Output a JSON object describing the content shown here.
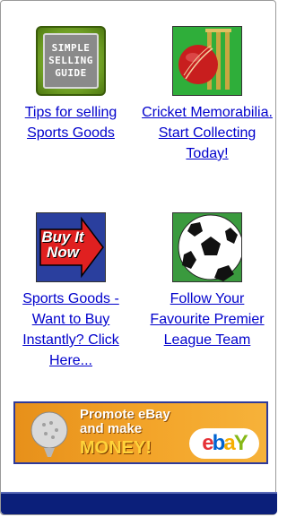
{
  "tiles": [
    {
      "image_lines": [
        "SIMPLE",
        "SELLING",
        "GUIDE"
      ],
      "link": "Tips for selling Sports Goods",
      "icon": "simple-selling-guide-icon"
    },
    {
      "link": "Cricket Memorabilia. Start Collecting Today!",
      "icon": "cricket-ball-stumps-icon"
    },
    {
      "image_lines": [
        "Buy It",
        "Now"
      ],
      "link": "Sports Goods - Want to Buy Instantly? Click Here...",
      "icon": "buy-it-now-icon"
    },
    {
      "link": "Follow Your Favourite Premier League Team",
      "icon": "soccer-ball-icon"
    }
  ],
  "banner": {
    "line1": "Promote eBay",
    "line2": "and make",
    "line3": "MONEY!",
    "logo_letters": [
      "e",
      "b",
      "a",
      "Y"
    ],
    "colors": {
      "background": "#f3a52a",
      "border": "#2e3a9a",
      "ebay_e": "#e53238",
      "ebay_b": "#0064d2",
      "ebay_a": "#f5af02",
      "ebay_y": "#86b817"
    }
  },
  "colors": {
    "link": "#0000cc",
    "footer": "#0b1f7a"
  }
}
